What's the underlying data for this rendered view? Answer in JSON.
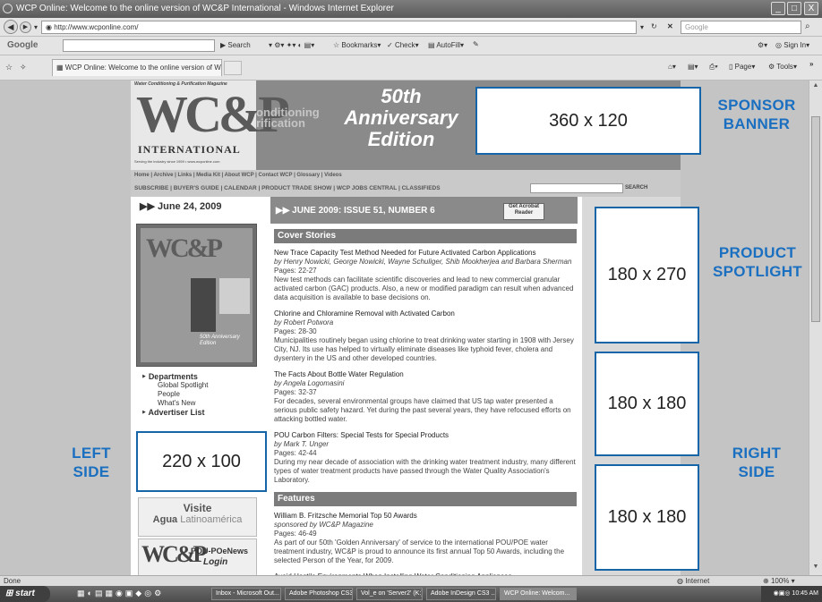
{
  "window": {
    "title": "WCP Online: Welcome to the online version of WC&P International - Windows Internet Explorer",
    "min_label": "_",
    "max_label": "□",
    "close_label": "X"
  },
  "address_bar": {
    "url": "http://www.wcponline.com/",
    "search_placeholder": "Google"
  },
  "google_toolbar": {
    "brand": "Google",
    "search_label": "Search",
    "bookmarks_label": "Bookmarks",
    "check_label": "Check",
    "autofill_label": "AutoFill",
    "sign_in_label": "Sign In"
  },
  "tab_bar": {
    "tab_title": "WCP Online: Welcome to the online version of WC&P ...",
    "page_label": "Page",
    "tools_label": "Tools"
  },
  "site": {
    "magazine_tag": "Water Conditioning & Purification Magazine",
    "logo_letters": "WC&P",
    "logo_word": "INTERNATIONAL",
    "logo_tagline": "Serving the industry since 1959 • www.wcponline.com",
    "logo_overlay": "onditioning rification",
    "anniversary_line1": "50th",
    "anniversary_line2": "Anniversary",
    "anniversary_line3": "Edition",
    "nav_primary": "Home | Archive | Links | Media Kit | About WCP | Contact WCP | Glossary | Videos",
    "nav_secondary": "SUBSCRIBE | BUYER'S GUIDE | CALENDAR | PRODUCT TRADE SHOW | WCP JOBS CENTRAL | CLASSIFIEDS",
    "search_button": "SEARCH",
    "date": "June 24, 2009",
    "cover_anniv": "50th Anniversary Edition",
    "issue_heading": "JUNE 2009: ISSUE 51, NUMBER 6",
    "acrobat_line1": "Get Acrobat",
    "acrobat_line2": "Reader",
    "sidebar": {
      "departments": "Departments",
      "global_spotlight": "Global Spotlight",
      "people": "People",
      "whats_new": "What's New",
      "advertiser_list": "Advertiser List"
    },
    "visite_line1": "Visite",
    "visite_line2_bold": "Agua",
    "visite_line2_light": "Latinoamérica",
    "pou_line1": "POU-POeNews",
    "pou_line2": "Login"
  },
  "cover_stories": {
    "heading": "Cover Stories",
    "articles": [
      {
        "title": "New Trace Capacity Test Method Needed for Future Activated Carbon Applications",
        "byline": "by Henry Nowicki, George Nowicki, Wayne Schuliger, Shib Mookherjea and Barbara Sherman",
        "pages": "Pages: 22-27",
        "summary": "New test methods can facilitate scientific discoveries and lead to new commercial granular activated carbon (GAC) products. Also, a new or modified paradigm can result when advanced data acquisition is available to base decisions on."
      },
      {
        "title": "Chlorine and Chloramine Removal with Activated Carbon",
        "byline": "by Robert Potwora",
        "pages": "Pages: 28-30",
        "summary": "Municipalities routinely began using chlorine to treat drinking water starting in 1908 with Jersey City, NJ. Its use has helped to virtually eliminate diseases like typhoid fever, cholera and dysentery in the US and other developed countries."
      },
      {
        "title": "The Facts About Bottle Water Regulation",
        "byline": "by Angela Logomasini",
        "pages": "Pages: 32-37",
        "summary": "For decades, several environmental groups have claimed that US tap water presented a serious public safety hazard. Yet during the past several years, they have refocused efforts on attacking bottled water."
      },
      {
        "title": "POU Carbon Filters: Special Tests for Special Products",
        "byline": "by Mark T. Unger",
        "pages": "Pages: 42-44",
        "summary": "During my near decade of association with the drinking water treatment industry, many different types of water treatment products have passed through the Water Quality Association's Laboratory."
      }
    ]
  },
  "features": {
    "heading": "Features",
    "articles": [
      {
        "title": "William B. Fritzsche Memorial Top 50 Awards",
        "byline": "sponsored by WC&P Magazine",
        "pages": "Pages: 46-49",
        "summary": "As part of our 50th 'Golden Anniversary' of service to the international POU/POE water treatment industry, WC&P is proud to announce its first annual Top 50 Awards, including the selected Person of the Year, for 2009."
      },
      {
        "title": "Avoid Hostile Environments When Installing Water Conditioning Appliances",
        "byline": "by Gary Battenberg",
        "pages": "Pages: 50-51",
        "summary": "For many years, I have been brought in to evaluate water conditioning installations to scertain the root cause of poor performance or premature failure of the treatment product(s)."
      }
    ]
  },
  "ad_slots": {
    "sponsor": "360 x 120",
    "product_spotlight": "180 x 270",
    "right_1": "180 x 180",
    "right_2": "180 x 180",
    "left": "220 x 100"
  },
  "callouts": {
    "sponsor_l1": "SPONSOR",
    "sponsor_l2": "BANNER",
    "product_l1": "PRODUCT",
    "product_l2": "SPOTLIGHT",
    "right_l1": "RIGHT",
    "right_l2": "SIDE",
    "left_l1": "LEFT",
    "left_l2": "SIDE"
  },
  "status_bar": {
    "left": "Done",
    "zone": "Internet",
    "zoom": "100%"
  },
  "taskbar": {
    "start": "start",
    "items": [
      "Inbox - Microsoft Out...",
      "Adobe Photoshop CS3",
      "Vol_e on 'Server2' (K:)",
      "Adobe InDesign CS3 ...",
      "WCP Online: Welcom..."
    ],
    "clock": "10:45 AM"
  },
  "colors": {
    "callout_blue": "#1a6fc0",
    "ad_border": "#1565a8",
    "section_header": "#7b7b7b"
  }
}
